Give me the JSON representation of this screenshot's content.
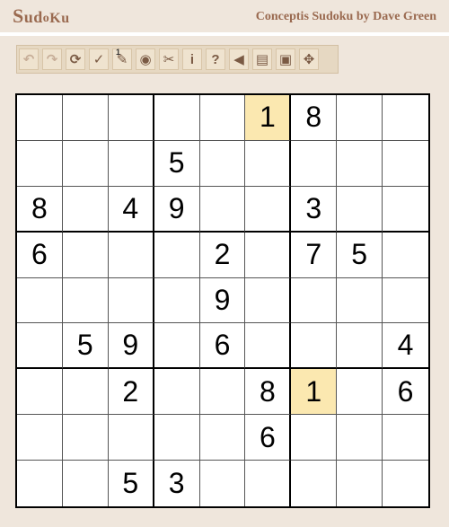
{
  "header": {
    "logo_text": "Sudoku",
    "byline": "Conceptis Sudoku by Dave Green"
  },
  "toolbar": {
    "buttons": [
      {
        "name": "undo-button",
        "icon": "undo-icon",
        "glyph": "↶",
        "faded": true
      },
      {
        "name": "redo-button",
        "icon": "redo-icon",
        "glyph": "↷",
        "faded": true
      },
      {
        "name": "restart-button",
        "icon": "refresh-icon",
        "glyph": "⟳",
        "faded": false
      },
      {
        "name": "check-button",
        "icon": "checkmark-icon",
        "glyph": "✓",
        "faded": false
      },
      {
        "name": "pencil-mode-button",
        "icon": "pencil-icon",
        "glyph": "✎",
        "faded": false,
        "badge": "1"
      },
      {
        "name": "reveal-button",
        "icon": "eye-icon",
        "glyph": "◉",
        "faded": false
      },
      {
        "name": "tools-button",
        "icon": "tools-icon",
        "glyph": "✂",
        "faded": false
      },
      {
        "name": "info-button",
        "icon": "info-icon",
        "glyph": "i",
        "faded": false
      },
      {
        "name": "help-button",
        "icon": "question-icon",
        "glyph": "?",
        "faded": false
      },
      {
        "name": "sound-button",
        "icon": "speaker-icon",
        "glyph": "◀",
        "faded": false
      },
      {
        "name": "print-button",
        "icon": "printer-icon",
        "glyph": "▤",
        "faded": false
      },
      {
        "name": "save-button",
        "icon": "floppy-disk-icon",
        "glyph": "▣",
        "faded": false
      },
      {
        "name": "puzzle-button",
        "icon": "puzzle-piece-icon",
        "glyph": "✥",
        "faded": false
      }
    ]
  },
  "board": {
    "grid": [
      [
        "",
        "",
        "",
        "",
        "",
        "1",
        "8",
        "",
        ""
      ],
      [
        "",
        "",
        "",
        "5",
        "",
        "",
        "",
        "",
        ""
      ],
      [
        "8",
        "",
        "4",
        "9",
        "",
        "",
        "3",
        "",
        ""
      ],
      [
        "6",
        "",
        "",
        "",
        "2",
        "",
        "7",
        "5",
        ""
      ],
      [
        "",
        "",
        "",
        "",
        "9",
        "",
        "",
        "",
        ""
      ],
      [
        "",
        "5",
        "9",
        "",
        "6",
        "",
        "",
        "",
        "4"
      ],
      [
        "",
        "",
        "2",
        "",
        "",
        "8",
        "1",
        "",
        "6"
      ],
      [
        "",
        "",
        "",
        "",
        "",
        "6",
        "",
        "",
        ""
      ],
      [
        "",
        "",
        "5",
        "3",
        "",
        "",
        "",
        "",
        ""
      ]
    ],
    "highlighted_cells": [
      [
        0,
        5
      ],
      [
        6,
        6
      ]
    ],
    "highlight_color": "#fbe8b0"
  }
}
